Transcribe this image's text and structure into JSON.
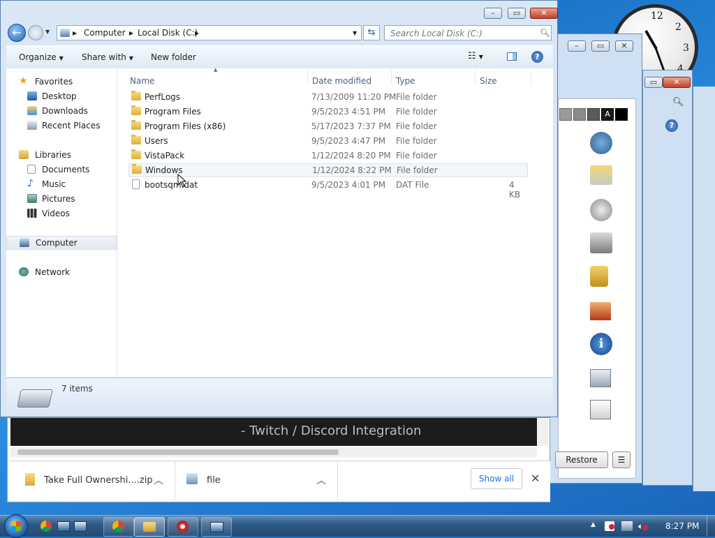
{
  "explorer": {
    "breadcrumb": [
      "Computer",
      "Local Disk (C:)"
    ],
    "search_placeholder": "Search Local Disk (C:)",
    "commands": {
      "organize": "Organize",
      "share_with": "Share with",
      "new_folder": "New folder"
    },
    "nav": {
      "favorites": "Favorites",
      "favorites_items": [
        "Desktop",
        "Downloads",
        "Recent Places"
      ],
      "libraries": "Libraries",
      "libraries_items": [
        "Documents",
        "Music",
        "Pictures",
        "Videos"
      ],
      "computer": "Computer",
      "network": "Network"
    },
    "columns": {
      "name": "Name",
      "date": "Date modified",
      "type": "Type",
      "size": "Size"
    },
    "files": [
      {
        "name": "PerfLogs",
        "date": "7/13/2009 11:20 PM",
        "type": "File folder",
        "size": ""
      },
      {
        "name": "Program Files",
        "date": "9/5/2023 4:51 PM",
        "type": "File folder",
        "size": ""
      },
      {
        "name": "Program Files (x86)",
        "date": "5/17/2023 7:37 PM",
        "type": "File folder",
        "size": ""
      },
      {
        "name": "Users",
        "date": "9/5/2023 4:47 PM",
        "type": "File folder",
        "size": ""
      },
      {
        "name": "VistaPack",
        "date": "1/12/2024 8:20 PM",
        "type": "File folder",
        "size": ""
      },
      {
        "name": "Windows",
        "date": "1/12/2024 8:22 PM",
        "type": "File folder",
        "size": ""
      },
      {
        "name": "bootsqm.dat",
        "date": "9/5/2023 4:01 PM",
        "type": "DAT File",
        "size": "4 KB"
      }
    ],
    "item_count": "7 items"
  },
  "browser": {
    "video_text": [
      "- Twitch / Discord Integration"
    ],
    "downloads": [
      {
        "name": "Take Full Ownershi....zip"
      },
      {
        "name": "file"
      }
    ],
    "show_all": "Show all"
  },
  "background_window": {
    "restore_button": "Restore",
    "color_swatch_label": "A"
  },
  "clock_numbers": [
    "12",
    "2",
    "3",
    "4"
  ],
  "taskbar": {
    "time": "8:27 PM"
  }
}
